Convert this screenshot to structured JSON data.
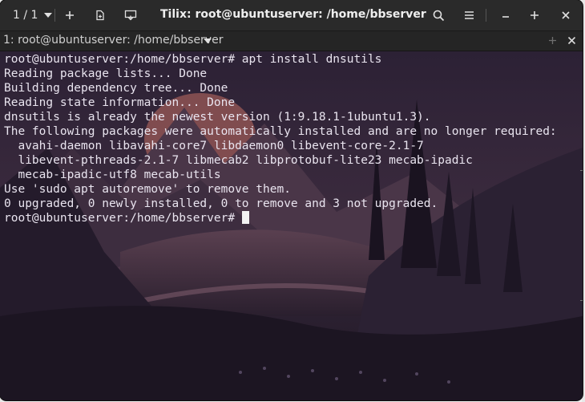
{
  "window": {
    "title": "Tilix: root@ubuntuserver: /home/bbserver",
    "session_count": "1 / 1"
  },
  "tab": {
    "title": "1: root@ubuntuserver: /home/bbserver"
  },
  "terminal": {
    "lines": [
      "root@ubuntuserver:/home/bbserver# apt install dnsutils",
      "Reading package lists... Done",
      "Building dependency tree... Done",
      "Reading state information... Done",
      "dnsutils is already the newest version (1:9.18.1-1ubuntu1.3).",
      "The following packages were automatically installed and are no longer required:",
      "  avahi-daemon libavahi-core7 libdaemon0 libevent-core-2.1-7",
      "  libevent-pthreads-2.1-7 libmecab2 libprotobuf-lite23 mecab-ipadic",
      "  mecab-ipadic-utf8 mecab-utils",
      "Use 'sudo apt autoremove' to remove them.",
      "0 upgraded, 0 newly installed, 0 to remove and 3 not upgraded."
    ],
    "prompt": "root@ubuntuserver:/home/bbserver#"
  },
  "icons": [
    "add-icon",
    "detach-icon",
    "sync-input-icon",
    "search-icon",
    "hamburger-menu-icon",
    "minimize-icon",
    "maximize-icon",
    "close-icon",
    "chevron-down-icon"
  ],
  "colors": {
    "header_bg": "#2a2a2a",
    "terminal_text": "#e9e4ef",
    "wallpaper_sky": "#2b1f33",
    "wallpaper_sun": "#a5605a"
  }
}
